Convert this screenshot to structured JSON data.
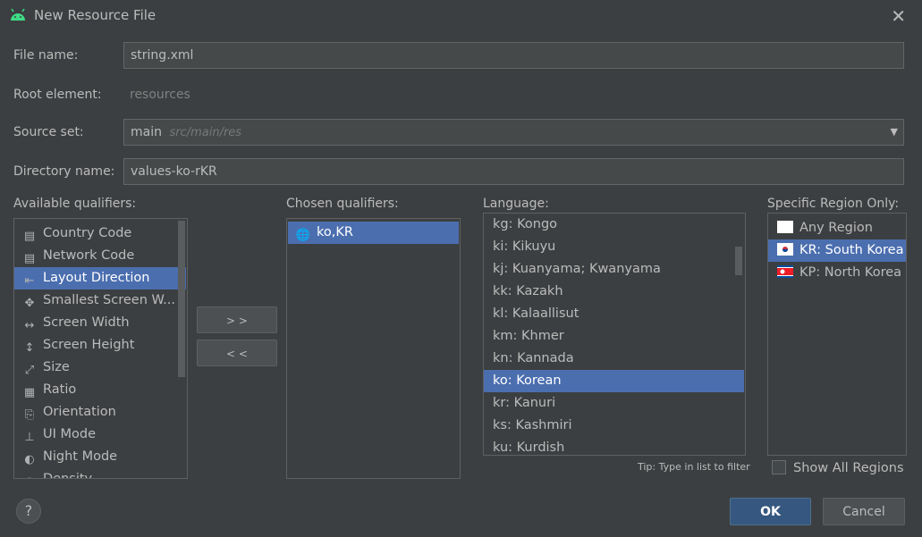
{
  "window": {
    "title": "New Resource File",
    "close_glyph": "✕"
  },
  "form": {
    "file_name_label": "File name:",
    "file_name_value": "string.xml",
    "root_element_label": "Root element:",
    "root_element_value": "resources",
    "source_set_label": "Source set:",
    "source_set_value": "main",
    "source_set_path": "src/main/res",
    "directory_name_label": "Directory name:",
    "directory_name_value": "values-ko-rKR"
  },
  "available": {
    "label": "Available qualifiers:",
    "items": [
      {
        "label": "Country Code",
        "icon": "country-code-icon",
        "glyph": "▤"
      },
      {
        "label": "Network Code",
        "icon": "network-code-icon",
        "glyph": "▤"
      },
      {
        "label": "Layout Direction",
        "icon": "layout-direction-icon",
        "glyph": "⇤"
      },
      {
        "label": "Smallest Screen W...",
        "icon": "smallest-screen-width-icon",
        "glyph": "✥"
      },
      {
        "label": "Screen Width",
        "icon": "screen-width-icon",
        "glyph": "↔"
      },
      {
        "label": "Screen Height",
        "icon": "screen-height-icon",
        "glyph": "↕"
      },
      {
        "label": "Size",
        "icon": "size-icon",
        "glyph": "⤢"
      },
      {
        "label": "Ratio",
        "icon": "ratio-icon",
        "glyph": "▦"
      },
      {
        "label": "Orientation",
        "icon": "orientation-icon",
        "glyph": "⎘"
      },
      {
        "label": "UI Mode",
        "icon": "ui-mode-icon",
        "glyph": "⊥"
      },
      {
        "label": "Night Mode",
        "icon": "night-mode-icon",
        "glyph": "◐"
      },
      {
        "label": "Density",
        "icon": "density-icon",
        "glyph": "◍"
      }
    ],
    "selected_index": 2
  },
  "buttons": {
    "add": "> >",
    "remove": "< <",
    "ok": "OK",
    "cancel": "Cancel",
    "help": "?"
  },
  "chosen": {
    "label": "Chosen qualifiers:",
    "items": [
      {
        "label": "ko,KR",
        "icon": "globe-icon"
      }
    ]
  },
  "language": {
    "label": "Language:",
    "items": [
      "kg: Kongo",
      "ki: Kikuyu",
      "kj: Kuanyama; Kwanyama",
      "kk: Kazakh",
      "kl: Kalaallisut",
      "km: Khmer",
      "kn: Kannada",
      "ko: Korean",
      "kr: Kanuri",
      "ks: Kashmiri",
      "ku: Kurdish"
    ],
    "selected_index": 7,
    "tip": "Tip: Type in list to filter"
  },
  "region": {
    "label": "Specific Region Only:",
    "items": [
      {
        "label": "Any Region",
        "flag": "blank"
      },
      {
        "label": "KR: South Korea",
        "flag": "kr"
      },
      {
        "label": "KP: North Korea",
        "flag": "kp"
      }
    ],
    "selected_index": 1,
    "show_all_label": "Show All Regions"
  }
}
